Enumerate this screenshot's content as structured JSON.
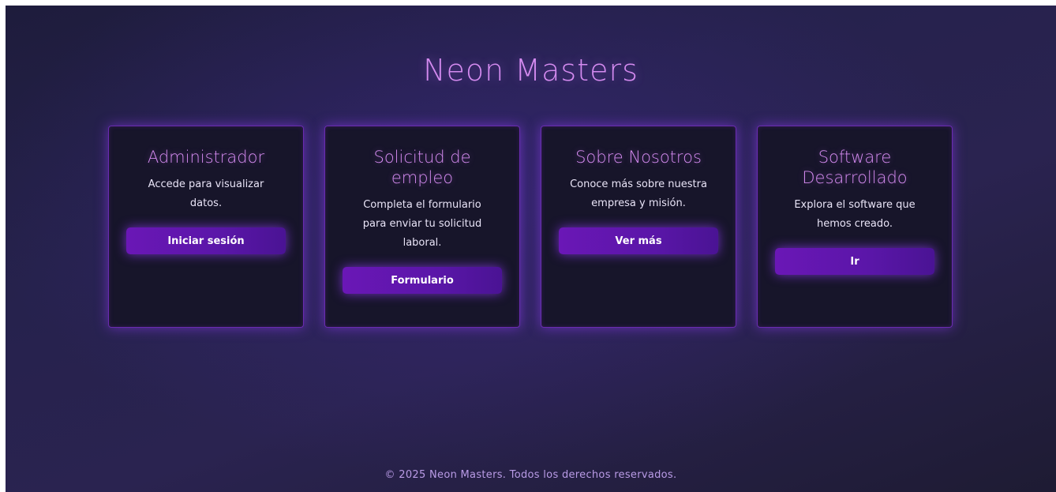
{
  "header": {
    "title": "Neon Masters"
  },
  "cards": [
    {
      "title": "Administrador",
      "description": "Accede para visualizar datos.",
      "button_label": "Iniciar sesión"
    },
    {
      "title": "Solicitud de empleo",
      "description": "Completa el formulario para enviar tu solicitud laboral.",
      "button_label": "Formulario"
    },
    {
      "title": "Sobre Nosotros",
      "description": "Conoce más sobre nuestra empresa y misión.",
      "button_label": "Ver más"
    },
    {
      "title": "Software Desarrollado",
      "description": "Explora el software que hemos creado.",
      "button_label": "Ir"
    }
  ],
  "footer": {
    "text": "© 2025 Neon Masters. Todos los derechos reservados."
  },
  "colors": {
    "accent": "#d58bf0",
    "button": "#6a17b6",
    "card_border": "#6a2bb0",
    "background": "#26224d"
  }
}
